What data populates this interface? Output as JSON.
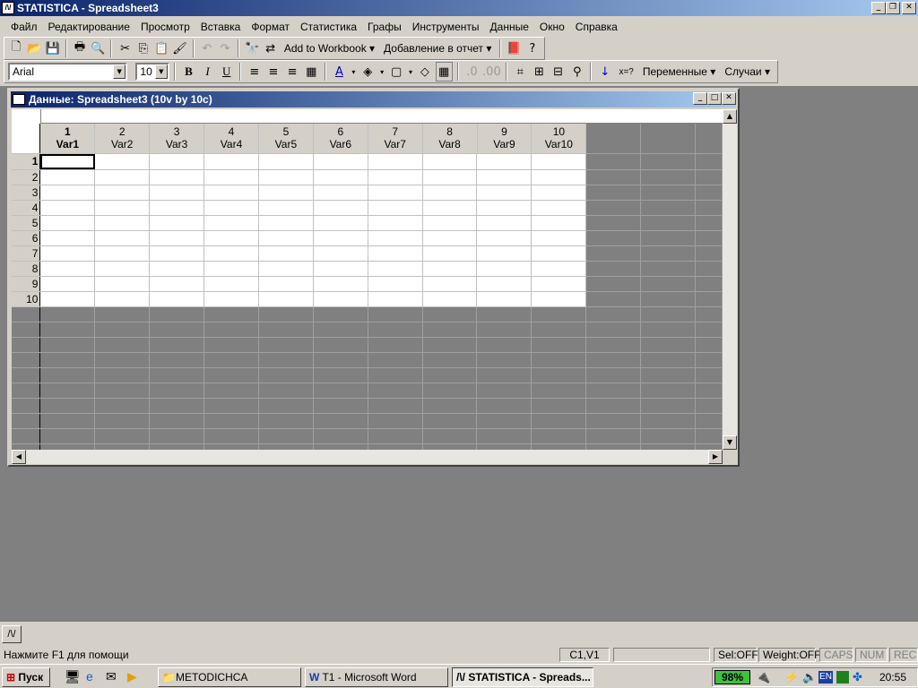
{
  "app": {
    "title": "STATISTICA - Spreadsheet3"
  },
  "menu": [
    "Файл",
    "Редактирование",
    "Просмотр",
    "Вставка",
    "Формат",
    "Статистика",
    "Графы",
    "Инструменты",
    "Данные",
    "Окно",
    "Справка"
  ],
  "toolbar": {
    "add_to_workbook": "Add to Workbook",
    "add_to_report": "Добавление в отчет",
    "font_name": "Arial",
    "font_size": "10",
    "bold": "B",
    "italic": "I",
    "underline": "U",
    "variables": "Переменные",
    "cases": "Случаи",
    "x_eq": "x=?"
  },
  "spreadsheet": {
    "title": "Данные: Spreadsheet3 (10v by 10c)",
    "columns": [
      {
        "num": "1",
        "name": "Var1"
      },
      {
        "num": "2",
        "name": "Var2"
      },
      {
        "num": "3",
        "name": "Var3"
      },
      {
        "num": "4",
        "name": "Var4"
      },
      {
        "num": "5",
        "name": "Var5"
      },
      {
        "num": "6",
        "name": "Var6"
      },
      {
        "num": "7",
        "name": "Var7"
      },
      {
        "num": "8",
        "name": "Var8"
      },
      {
        "num": "9",
        "name": "Var9"
      },
      {
        "num": "10",
        "name": "Var10"
      }
    ],
    "rows": [
      "1",
      "2",
      "3",
      "4",
      "5",
      "6",
      "7",
      "8",
      "9",
      "10"
    ]
  },
  "status": {
    "help": "Нажмите F1 для помощи",
    "cell": "C1,V1",
    "sel": "Sel:OFF",
    "weight": "Weight:OFF",
    "caps": "CAPS",
    "num": "NUM",
    "rec": "REC"
  },
  "taskbar": {
    "start": "Пуск",
    "tasks": [
      "METODICHCA",
      "T1 - Microsoft Word",
      "STATISTICA - Spreads..."
    ],
    "battery": "98%",
    "lang": "EN",
    "clock": "20:55"
  }
}
